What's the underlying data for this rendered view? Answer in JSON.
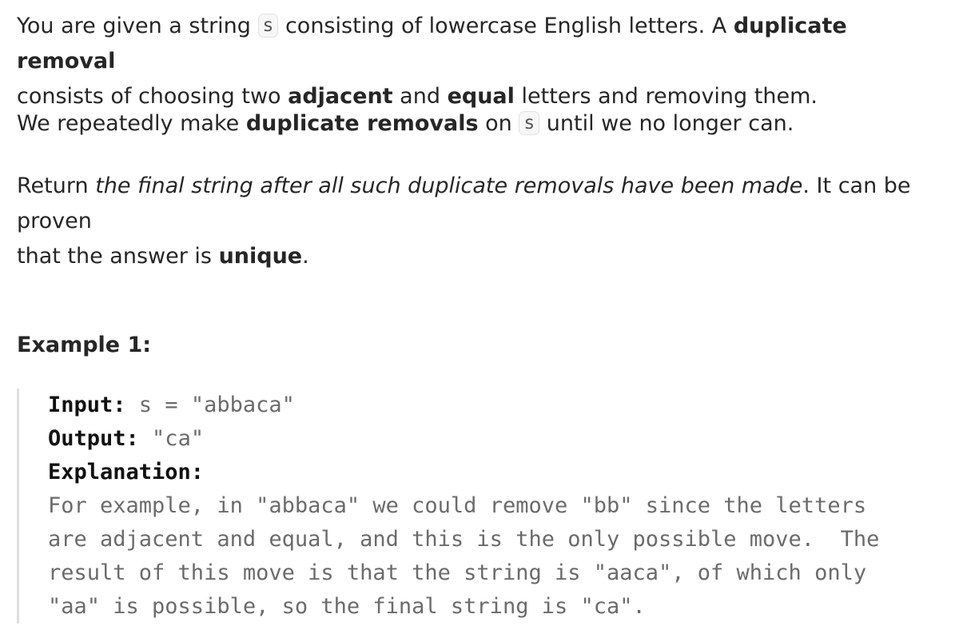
{
  "intro": {
    "t1": "You are given a string ",
    "code_s": "s",
    "t2": " consisting of lowercase English letters. A ",
    "b_duplicate_removal": "duplicate removal",
    "t3": "consists of choosing two ",
    "b_adjacent": "adjacent",
    "t4": " and ",
    "b_equal": "equal",
    "t5": " letters and removing them."
  },
  "repeat": {
    "t1": "We repeatedly make ",
    "b_duplicate_removals": "duplicate removals",
    "t2": " on ",
    "code_s": "s",
    "t3": " until we no longer can."
  },
  "return_para": {
    "t1": "Return ",
    "i_final": "the final string after all such duplicate removals have been made",
    "t2": ". It can be proven",
    "t3": "that the answer is ",
    "b_unique": "unique",
    "t4": "."
  },
  "example": {
    "heading": "Example 1:",
    "input_label": "Input:",
    "input_value": " s = \"abbaca\"",
    "output_label": "Output:",
    "output_value": " \"ca\"",
    "explanation_label": "Explanation:",
    "explanation_lines": [
      "For example, in \"abbaca\" we could remove \"bb\" since the letters",
      "are adjacent and equal, and this is the only possible move.  The",
      "result of this move is that the string is \"aaca\", of which only",
      "\"aa\" is possible, so the final string is \"ca\"."
    ]
  },
  "colors": {
    "text": "#262626",
    "code_text": "#6b6b6b",
    "code_border": "#e2e2e2",
    "block_border": "#dedede"
  }
}
